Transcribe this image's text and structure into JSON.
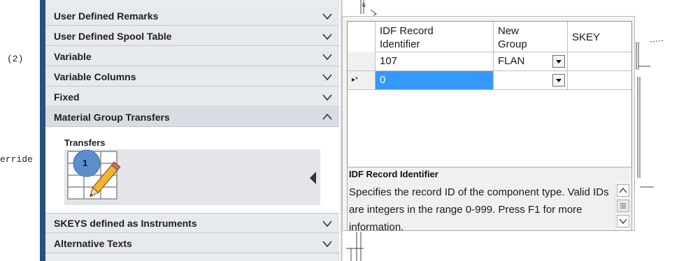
{
  "background": {
    "left_fragments": [
      "(2)",
      "erride"
    ],
    "drawing_marker": "N"
  },
  "panel": {
    "sections": [
      {
        "label": "User Defined Remarks",
        "state": "collapsed"
      },
      {
        "label": "User Defined Spool Table",
        "state": "collapsed"
      },
      {
        "label": "Variable",
        "state": "collapsed"
      },
      {
        "label": "Variable Columns",
        "state": "collapsed"
      },
      {
        "label": "Fixed",
        "state": "collapsed"
      },
      {
        "label": "Material Group Transfers",
        "state": "expanded"
      },
      {
        "label": "SKEYS defined as Instruments",
        "state": "collapsed"
      },
      {
        "label": "Alternative Texts",
        "state": "collapsed"
      }
    ],
    "transfers": {
      "label": "Transfers",
      "badge": "1",
      "icon": "table-pencil-icon"
    }
  },
  "grid": {
    "columns": [
      "IDF Record Identifier",
      "New Group",
      "SKEY"
    ],
    "rows": [
      {
        "marker": "",
        "idf": "107",
        "group": "FLAN",
        "skey": ""
      },
      {
        "marker": "▸*",
        "idf": "0",
        "group": "",
        "skey": ""
      }
    ],
    "selected_color": "#3399ff"
  },
  "help": {
    "title": "IDF Record Identifier",
    "text": "Specifies the record ID of the component type. Valid IDs are integers in the range 0-999. Press F1 for more information."
  },
  "colors": {
    "accent_bar": "#2a4f7d",
    "selection": "#3399ff"
  }
}
